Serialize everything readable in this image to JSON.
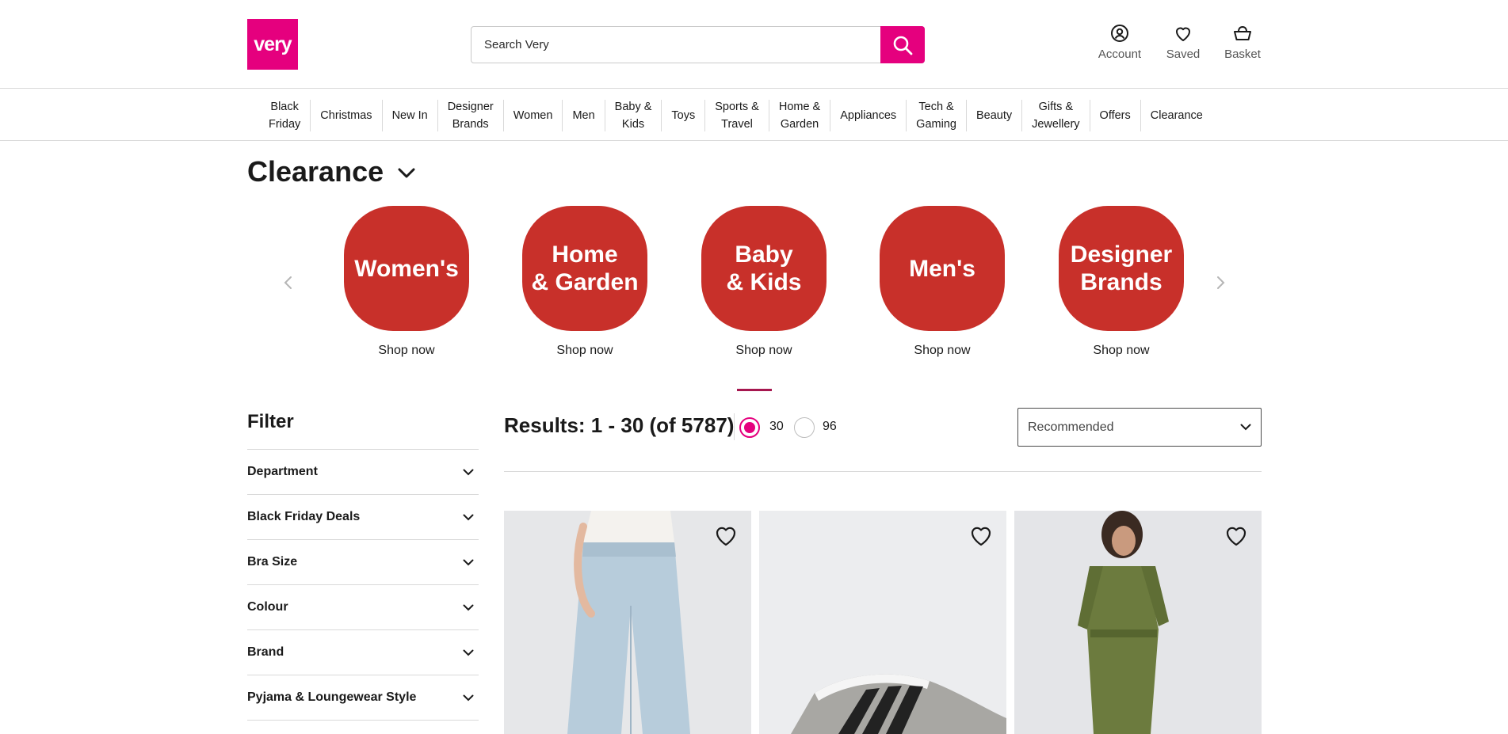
{
  "header": {
    "logo_text": "very",
    "search": {
      "placeholder": "Search Very"
    },
    "account_label": "Account",
    "saved_label": "Saved",
    "basket_label": "Basket",
    "brand_color": "#e5007e"
  },
  "nav": {
    "items": [
      "Black\nFriday",
      "Christmas",
      "New In",
      "Designer\nBrands",
      "Women",
      "Men",
      "Baby &\nKids",
      "Toys",
      "Sports &\nTravel",
      "Home &\nGarden",
      "Appliances",
      "Tech &\nGaming",
      "Beauty",
      "Gifts &\nJewellery",
      "Offers",
      "Clearance"
    ]
  },
  "page_title": "Clearance",
  "carousel": {
    "tile_color": "#c8302a",
    "categories": [
      {
        "label": "Women's",
        "link": "Shop now"
      },
      {
        "label": "Home\n& Garden",
        "link": "Shop now"
      },
      {
        "label": "Baby\n& Kids",
        "link": "Shop now"
      },
      {
        "label": "Men's",
        "link": "Shop now"
      },
      {
        "label": "Designer\nBrands",
        "link": "Shop now"
      }
    ]
  },
  "filter": {
    "title": "Filter",
    "items": [
      "Department",
      "Black Friday Deals",
      "Bra Size",
      "Colour",
      "Brand",
      "Pyjama & Loungewear Style"
    ]
  },
  "results": {
    "summary": "Results: 1 - 30 (of 5787)",
    "per_page_options": [
      "30",
      "96"
    ],
    "per_page_selected": "30",
    "sort_selected": "Recommended"
  },
  "products": [
    {
      "image": "light-blue-wide-leg-jeans",
      "icon": "heart-icon"
    },
    {
      "image": "adidas-grey-trainer",
      "icon": "heart-icon"
    },
    {
      "image": "khaki-broderie-jumpsuit",
      "icon": "heart-icon"
    }
  ]
}
